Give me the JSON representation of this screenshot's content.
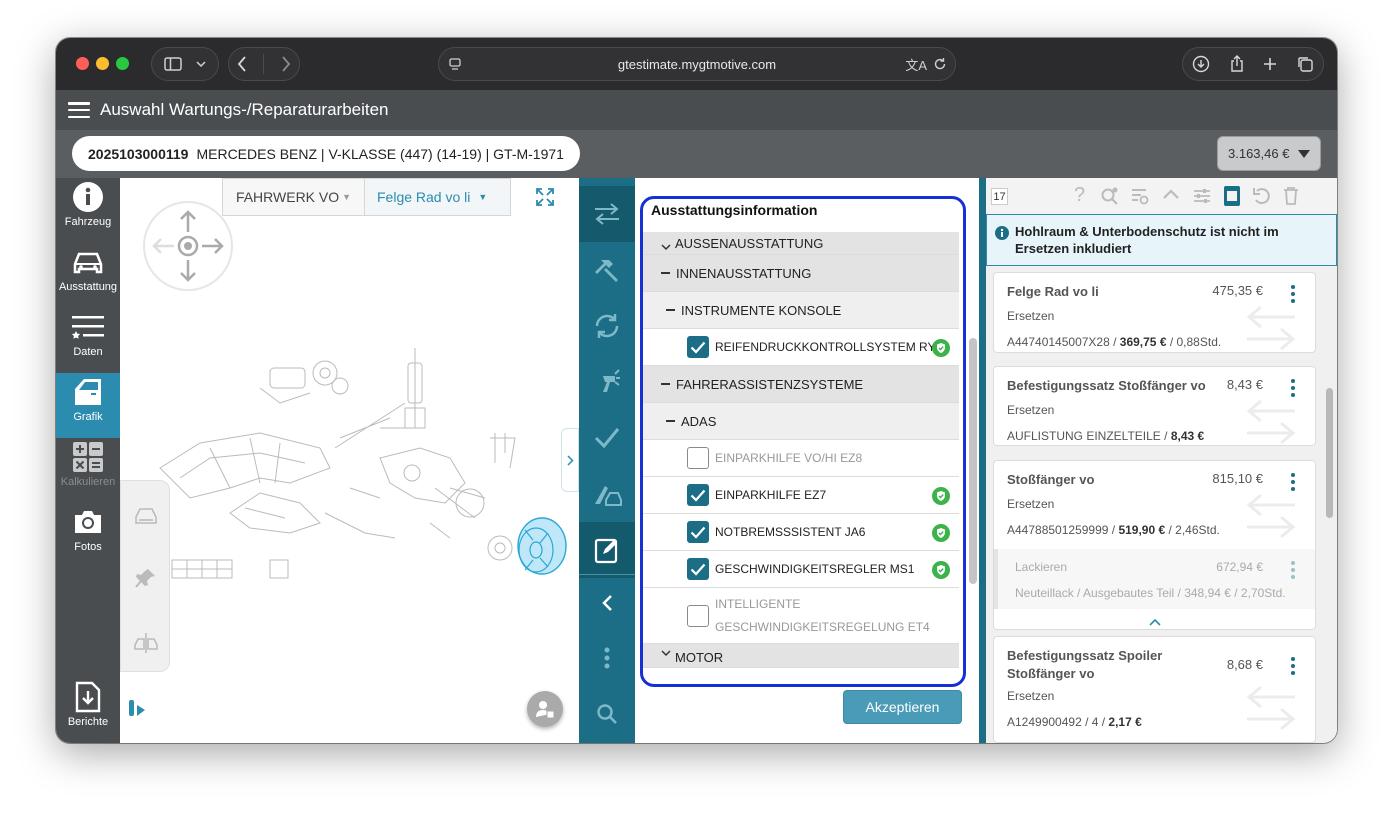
{
  "browser": {
    "url": "gtestimate.mygtmotive.com"
  },
  "app": {
    "title": "Auswahl Wartungs-/Reparaturarbeiten"
  },
  "vehicle": {
    "id": "2025103000119",
    "desc": "MERCEDES BENZ | V-KLASSE (447) (14-19) | GT-M-1971",
    "total": "3.163,46 €"
  },
  "nav": {
    "fahrzeug": "Fahrzeug",
    "ausstattung": "Ausstattung",
    "daten": "Daten",
    "grafik": "Grafik",
    "kalkulieren": "Kalkulieren",
    "fotos": "Fotos",
    "berichte": "Berichte"
  },
  "graphic": {
    "group": "FAHRWERK VO",
    "part": "Felge Rad vo li"
  },
  "equipment": {
    "title": "Ausstattungsinformation",
    "rows": [
      {
        "type": "cat",
        "label": "AUSSENAUSSTATTUNG"
      },
      {
        "type": "cat",
        "label": "INNENAUSSTATTUNG"
      },
      {
        "type": "sub",
        "label": "INSTRUMENTE KONSOLE"
      },
      {
        "type": "item",
        "label": "REIFENDRUCKKONTROLLSYSTEM RY2",
        "checked": true
      },
      {
        "type": "cat",
        "label": "FAHRERASSISTENZSYSTEME"
      },
      {
        "type": "sub",
        "label": "ADAS"
      },
      {
        "type": "item",
        "label": "EINPARKHILFE VO/HI EZ8",
        "checked": false
      },
      {
        "type": "item",
        "label": "EINPARKHILFE EZ7",
        "checked": true
      },
      {
        "type": "item",
        "label": "NOTBREMSSSISTENT JA6",
        "checked": true
      },
      {
        "type": "item",
        "label": "GESCHWINDIGKEITSREGLER MS1",
        "checked": true
      },
      {
        "type": "item2",
        "label1": "INTELLIGENTE",
        "label2": "GESCHWINDIGKEITSREGELUNG ET4",
        "checked": false
      },
      {
        "type": "cat",
        "label": "MOTOR"
      }
    ],
    "accept": "Akzeptieren"
  },
  "estimate": {
    "count": "17",
    "info": "Hohlraum & Unterbodenschutz ist nicht im Ersetzen inkludiert",
    "items": [
      {
        "name": "Felge Rad vo li",
        "price": "475,35 €",
        "action": "Ersetzen",
        "detail_pre": "A44740145007X28 / ",
        "detail_bold": "369,75 €",
        "detail_post": " / 0,88Std."
      },
      {
        "name": "Befestigungssatz Stoßfänger vo",
        "price": "8,43 €",
        "action": "Ersetzen",
        "detail_pre": "AUFLISTUNG EINZELTEILE / ",
        "detail_bold": "8,43 €",
        "detail_post": ""
      },
      {
        "name": "Stoßfänger vo",
        "price": "815,10 €",
        "action": "Ersetzen",
        "detail_pre": "A44788501259999 / ",
        "detail_bold": "519,90 €",
        "detail_post": " / 2,46Std."
      },
      {
        "name1": "Befestigungssatz Spoiler",
        "name2": "Stoßfänger vo",
        "price": "8,68 €",
        "action": "Ersetzen",
        "detail_pre": "A1249900492 / 4 / ",
        "detail_bold": "2,17 €",
        "detail_post": ""
      }
    ],
    "paint": {
      "label": "Lackieren",
      "price": "672,94 €",
      "detail": "Neuteillack / Ausgebautes Teil / 348,94 € / 2,70Std."
    }
  }
}
